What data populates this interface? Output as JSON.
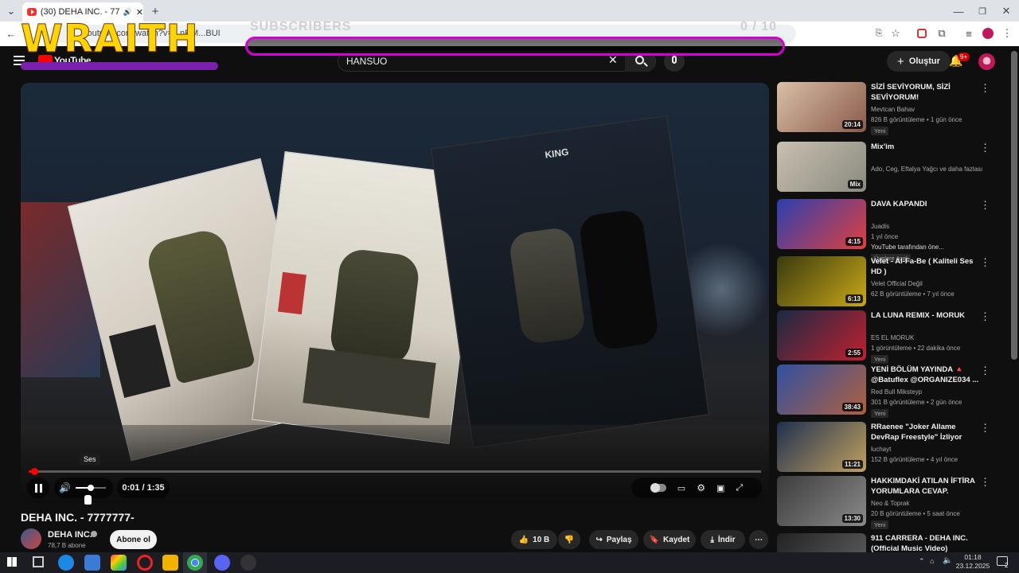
{
  "browser": {
    "tab_title": "(30) DEHA INC. - 7777777-",
    "address": "youtube.com/watch?v=...nRM...BUI"
  },
  "overlay": {
    "streamer_name": "WRAITH",
    "subs_label": "SUBSCRIBERS",
    "subs_count": "0 / 10"
  },
  "header": {
    "logo": "YouTube",
    "search_value": "HANSUO",
    "create_label": "Oluştur",
    "notifications": "9+"
  },
  "player": {
    "tooltip": "Ses",
    "time": "0:01 / 1:35",
    "progress": 0.01,
    "volume": 0.5,
    "overlay_text": "KING"
  },
  "video": {
    "title": "DEHA INC. - 7777777-",
    "channel": "DEHA INC.",
    "subscribers": "78,7 B abone",
    "subscribe_label": "Abone ol",
    "likes": "10 B",
    "share_label": "Paylaş",
    "save_label": "Kaydet",
    "download_label": "İndir"
  },
  "recommendations": [
    {
      "title": "SİZİ SEVİYORUM, SİZİ SEVİYORUM!",
      "channel": "Mevtcan Bahav",
      "verified": true,
      "meta": "826 B görüntüleme • 1 gün önce",
      "badge": "Yeni",
      "duration": "20:14"
    },
    {
      "title": "Mix'im",
      "channel": "Ado, Ceg, Eftalya Yağcı ve daha fazlası",
      "meta": "",
      "badge": "",
      "duration": "Mix"
    },
    {
      "title": "DAVA KAPANDI",
      "channel": "Juadis",
      "verified": true,
      "meta": "1 yıl önce",
      "extra": "YouTube tarafından öne...",
      "badge": "Üyelere özel",
      "duration": "4:15"
    },
    {
      "title": "Velet - Al-Fa-Be ( Kaliteli Ses HD )",
      "channel": "Velet Official Değil",
      "meta": "62 B görüntüleme • 7 yıl önce",
      "badge": "",
      "duration": "6:13"
    },
    {
      "title": "LA LUNA REMIX - MORUK",
      "channel": "ES EL MORUK",
      "meta": "1 görüntüleme • 22 dakika önce",
      "badge": "Yeni",
      "duration": "2:55"
    },
    {
      "title": "YENİ BÖLÜM YAYINDA 🔺 @Batuflex @ORGANIZE034 ...",
      "channel": "Red Bull Miksteyp",
      "verified": true,
      "meta": "301 B görüntüleme • 2 gün önce",
      "badge": "Yeni",
      "duration": "38:43"
    },
    {
      "title": "RRaenee \"Joker Allame DevRap Freestyle\" İzliyor",
      "channel": "luchayt",
      "meta": "152 B görüntüleme • 4 yıl önce",
      "badge": "",
      "duration": "11:21"
    },
    {
      "title": "HAKKIMDAKİ ATILAN İFTİRA YORUMLARA CEVAP.",
      "channel": "Neo & Toprak",
      "verified": true,
      "meta": "20 B görüntüleme • 5 saat önce",
      "badge": "Yeni",
      "duration": "13:30"
    },
    {
      "title": "911 CARRERA - DEHA INC. (Official Music Video)",
      "channel": "",
      "meta": "",
      "badge": "",
      "duration": ""
    }
  ],
  "taskbar": {
    "time": "01:18",
    "date": "23.12.2025",
    "notification_count": "2"
  }
}
